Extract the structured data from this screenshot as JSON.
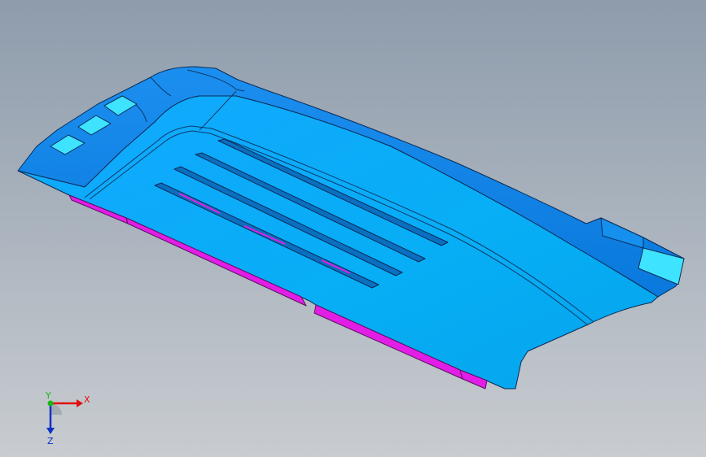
{
  "viewport": {
    "background_top": "#8e9cac",
    "background_bottom": "#c8ccd0"
  },
  "model": {
    "body_color": "#0aa6f5",
    "wall_color": "#0a86e6",
    "rim_color": "#1590ee",
    "slot_color": "#0a6fc0",
    "highlight_color": "#3ee3ff",
    "flange_color": "#e21ee6",
    "edge_color": "#0b2b57"
  },
  "triad": {
    "x_label": "X",
    "y_label": "Y",
    "z_label": "Z",
    "x_color": "#e01010",
    "y_color": "#18b818",
    "z_color": "#1030c8"
  }
}
